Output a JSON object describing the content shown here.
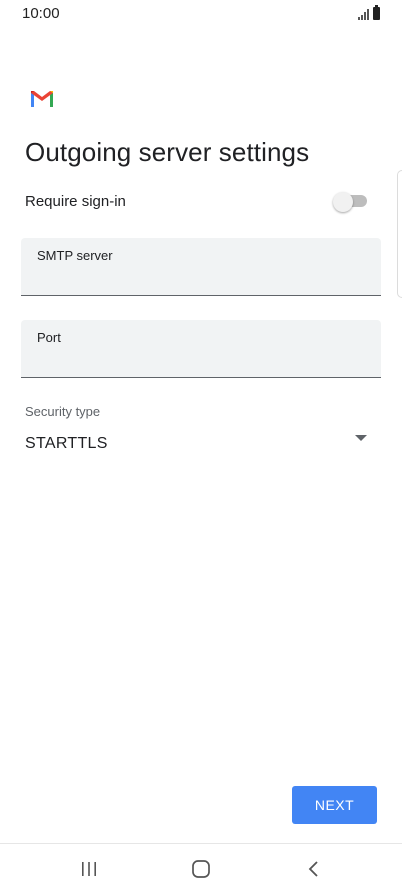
{
  "status_bar": {
    "time": "10:00",
    "signal_icon": "signal-icon",
    "battery_icon": "battery-icon"
  },
  "header": {
    "logo_icon": "gmail-logo-icon",
    "title": "Outgoing server settings"
  },
  "require_signin": {
    "label": "Require sign-in",
    "enabled": false
  },
  "smtp_server": {
    "label": "SMTP server",
    "value": ""
  },
  "port": {
    "label": "Port",
    "value": ""
  },
  "security": {
    "label": "Security type",
    "value": "STARTTLS"
  },
  "actions": {
    "next_label": "NEXT"
  },
  "nav_bar": {
    "recents_icon": "recents-icon",
    "home_icon": "home-icon",
    "back_icon": "back-icon"
  },
  "colors": {
    "accent": "#4285f4",
    "field_bg": "#f1f3f4",
    "text": "#202124"
  }
}
